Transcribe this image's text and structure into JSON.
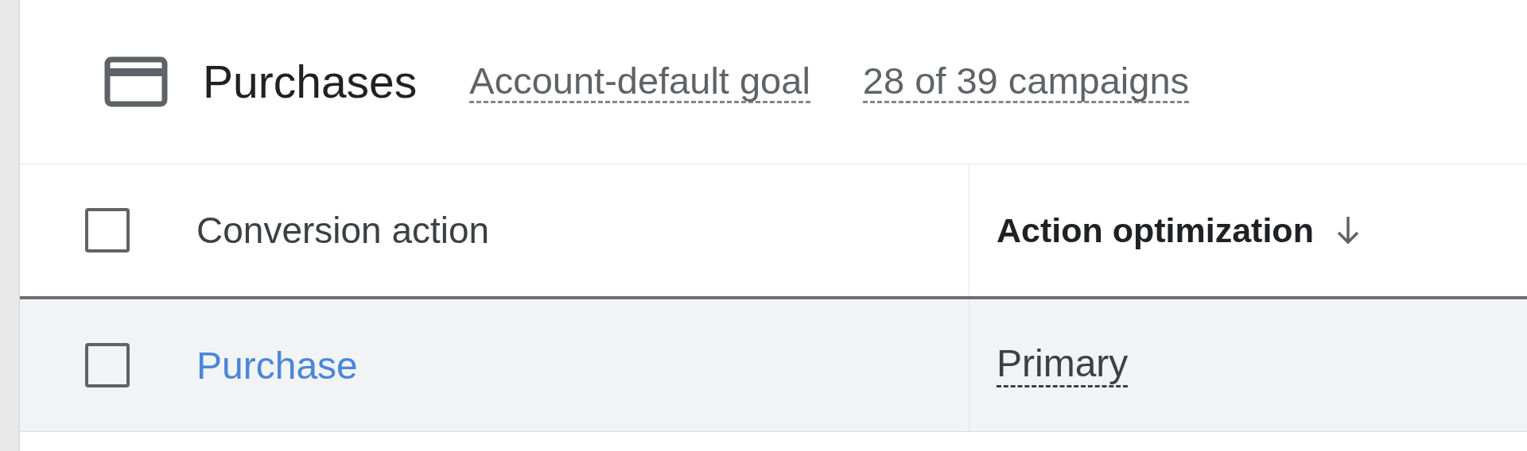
{
  "goal": {
    "title": "Purchases",
    "source": "Account-default goal",
    "campaigns": "28 of 39 campaigns"
  },
  "table": {
    "header_checked": false,
    "columns": [
      {
        "label": "Conversion action",
        "sorted": false
      },
      {
        "label": "Action optimization",
        "sorted": true
      }
    ],
    "rows": [
      {
        "checked": false,
        "action": "Purchase",
        "optimization": "Primary"
      }
    ]
  }
}
